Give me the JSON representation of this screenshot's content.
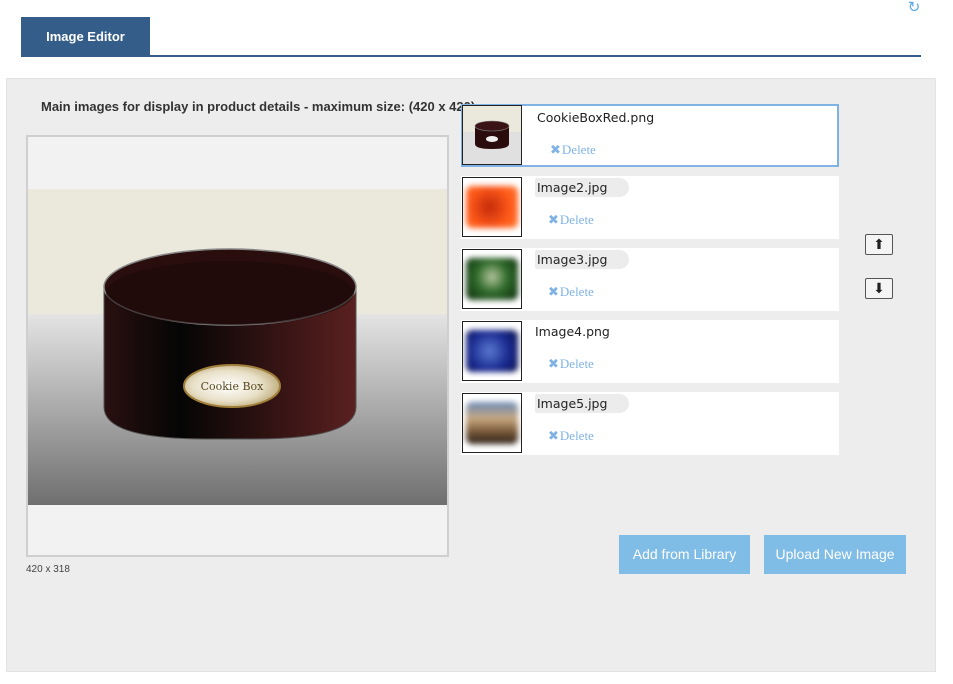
{
  "header": {
    "tab_label": "Image Editor",
    "refresh_icon": "refresh-icon"
  },
  "panel": {
    "heading": "Main images for display in product details - maximum size: (420 x 420)",
    "preview_dims": "420 x 318",
    "preview_label": "Cookie Box"
  },
  "images": [
    {
      "file": "CookieBoxRed.png",
      "delete": "Delete"
    },
    {
      "file": "Image2.jpg",
      "delete": "Delete"
    },
    {
      "file": "Image3.jpg",
      "delete": "Delete"
    },
    {
      "file": "Image4.png",
      "delete": "Delete"
    },
    {
      "file": "Image5.jpg",
      "delete": "Delete"
    }
  ],
  "reorder": {
    "up_icon": "arrow-up-icon",
    "down_icon": "arrow-down-icon"
  },
  "actions": {
    "add_from_library": "Add from Library",
    "upload_new_image": "Upload New Image"
  },
  "colors": {
    "tab": "#345d8a",
    "button": "#7fbce6",
    "link": "#7fb3e6",
    "selected_border": "#7fb3e6",
    "panel_bg": "#ededed"
  }
}
